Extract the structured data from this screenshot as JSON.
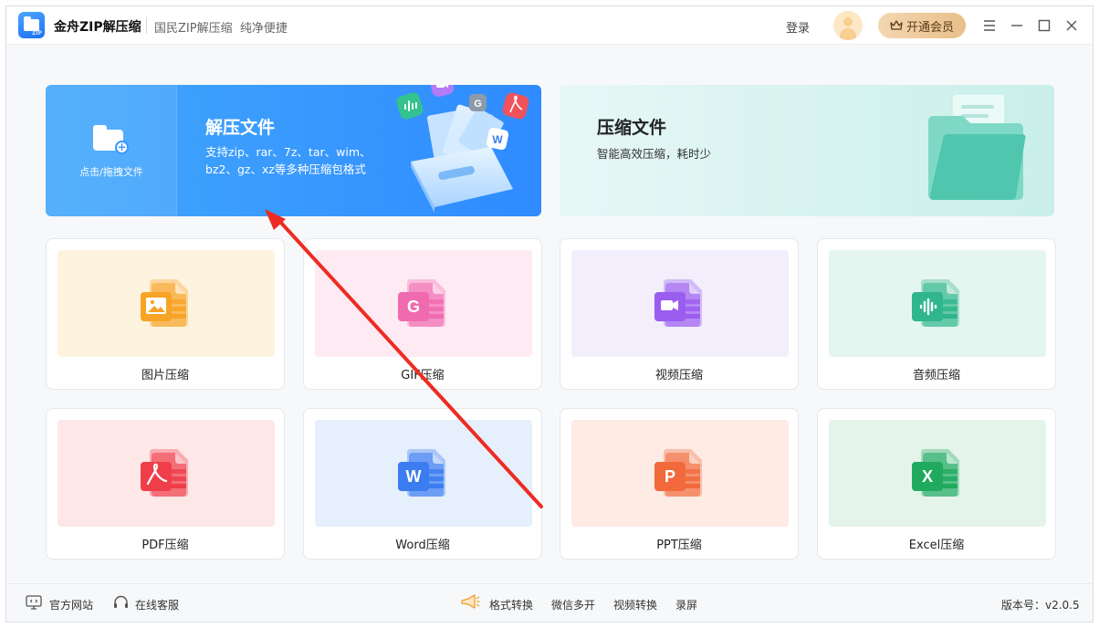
{
  "app": {
    "name": "金舟ZIP解压缩",
    "slogan": "国民ZIP解压缩  纯净便捷"
  },
  "header": {
    "login_label": "登录",
    "vip_label": "开通会员",
    "vip_icon": "crown-icon",
    "menu_icon": "hamburger-menu-icon",
    "minimize_icon": "minimize-icon",
    "maximize_icon": "maximize-icon",
    "close_icon": "close-icon"
  },
  "extract_banner": {
    "drop_label": "点击/拖拽文件",
    "title": "解压文件",
    "description": "支持zip、rar、7z、tar、wim、bz2、gz、xz等多种压缩包格式",
    "floating_badges": [
      "audio",
      "video",
      "G",
      "pdf",
      "W"
    ]
  },
  "compress_banner": {
    "title": "压缩文件",
    "description": "智能高效压缩，耗时少"
  },
  "tools": [
    {
      "label": "图片压缩",
      "icon": "image-file-icon",
      "glyph": "",
      "color": "#f7a325",
      "bg": "#fdf3de"
    },
    {
      "label": "GIF压缩",
      "icon": "gif-file-icon",
      "glyph": "G",
      "color": "#f06ab0",
      "bg": "#fdeaf3"
    },
    {
      "label": "视频压缩",
      "icon": "video-file-icon",
      "glyph": "",
      "color": "#9b5cf0",
      "bg": "#f2eefb"
    },
    {
      "label": "音频压缩",
      "icon": "audio-file-icon",
      "glyph": "",
      "color": "#2fb68c",
      "bg": "#e5f5ef"
    },
    {
      "label": "PDF压缩",
      "icon": "pdf-file-icon",
      "glyph": "",
      "color": "#ef3e4a",
      "bg": "#fde7e7"
    },
    {
      "label": "Word压缩",
      "icon": "word-file-icon",
      "glyph": "W",
      "color": "#3b7cf0",
      "bg": "#e6effc"
    },
    {
      "label": "PPT压缩",
      "icon": "ppt-file-icon",
      "glyph": "P",
      "color": "#f26a3c",
      "bg": "#fdebe4"
    },
    {
      "label": "Excel压缩",
      "icon": "excel-file-icon",
      "glyph": "X",
      "color": "#1faa60",
      "bg": "#e5f4ea"
    }
  ],
  "footer": {
    "website_label": "官方网站",
    "support_label": "在线客服",
    "links": [
      "格式转换",
      "微信多开",
      "视频转换",
      "录屏"
    ],
    "version_label": "版本号：v2.0.5"
  }
}
